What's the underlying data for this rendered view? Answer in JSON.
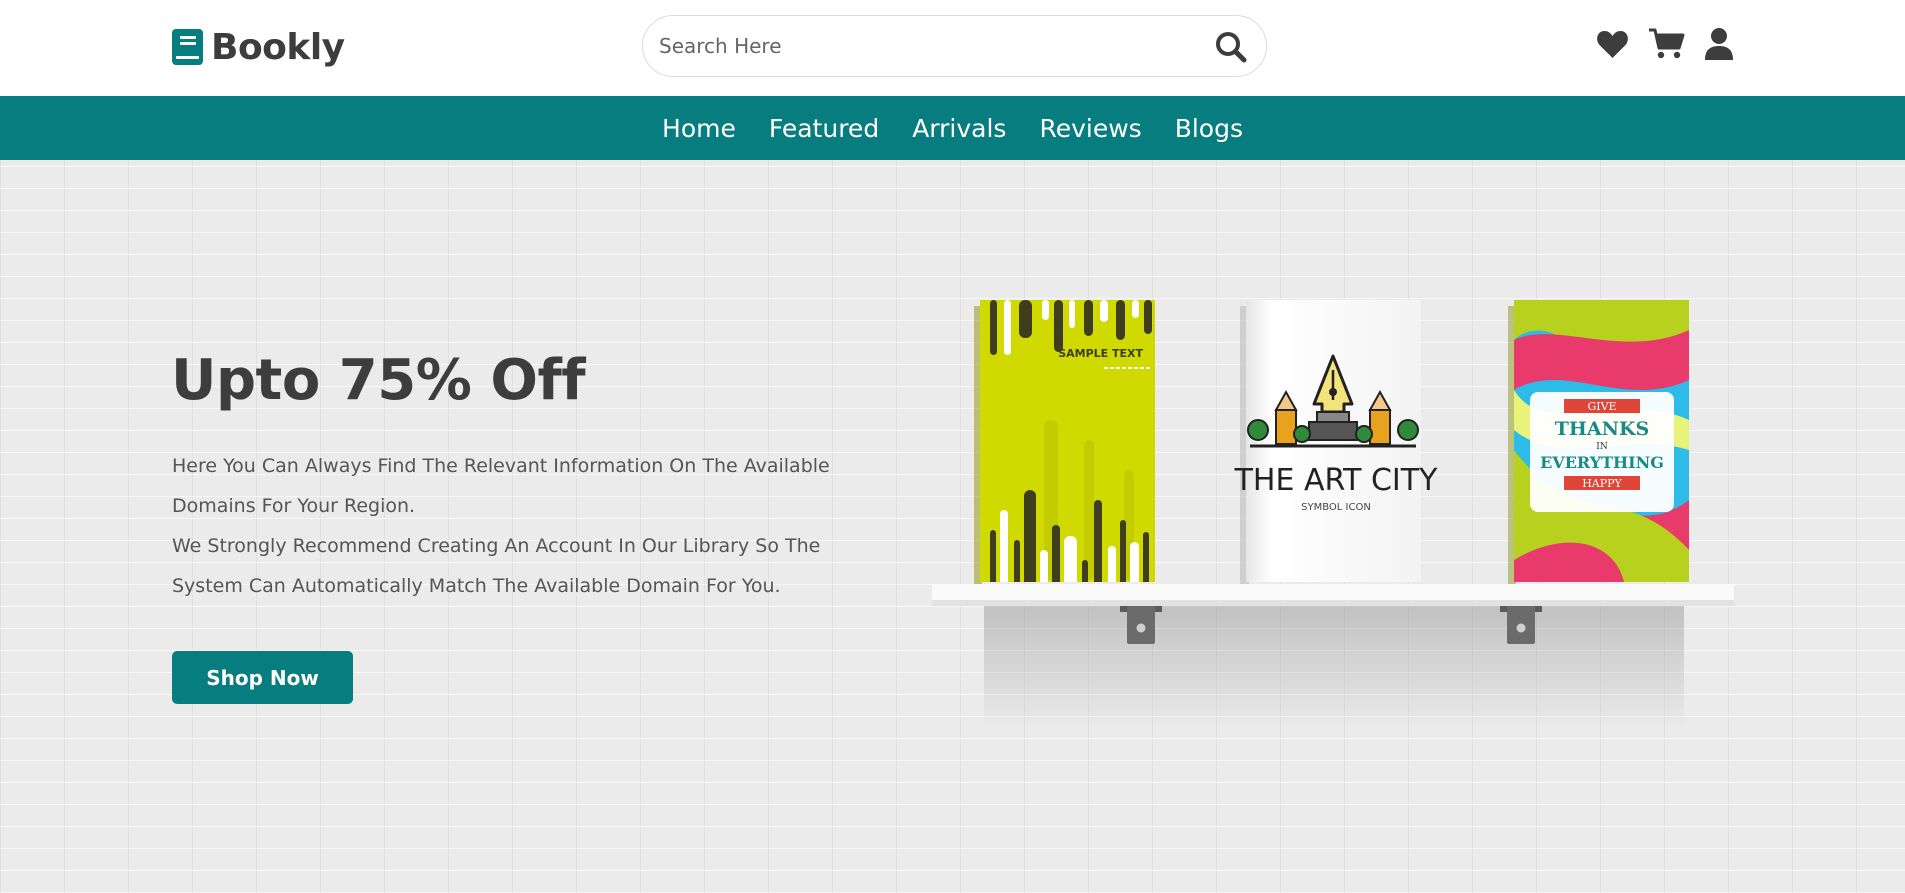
{
  "brand": {
    "name": "Bookly",
    "color": "#087d80"
  },
  "search": {
    "placeholder": "Search Here",
    "icon": "search-icon"
  },
  "header_icons": [
    "heart-icon",
    "cart-icon",
    "user-icon"
  ],
  "nav": {
    "items": [
      {
        "label": "Home"
      },
      {
        "label": "Featured"
      },
      {
        "label": "Arrivals"
      },
      {
        "label": "Reviews"
      },
      {
        "label": "Blogs"
      }
    ]
  },
  "hero": {
    "title": "Upto 75% Off",
    "paragraph_line1": "Here You Can Always Find The Relevant Information On The Available Domains For Your Region.",
    "paragraph_line2": "We Strongly Recommend Creating An Account In Our Library So The System Can Automatically Match The Available Domain For You.",
    "button_label": "Shop Now"
  },
  "books": {
    "book1_text": "SAMPLE TEXT",
    "book2_title": "THE ART CITY",
    "book2_subtitle": "SYMBOL ICON",
    "book3_line1": "GIVE",
    "book3_line2": "THANKS",
    "book3_line3": "IN",
    "book3_line4": "EVERYTHING",
    "book3_line5": "HAPPY"
  }
}
